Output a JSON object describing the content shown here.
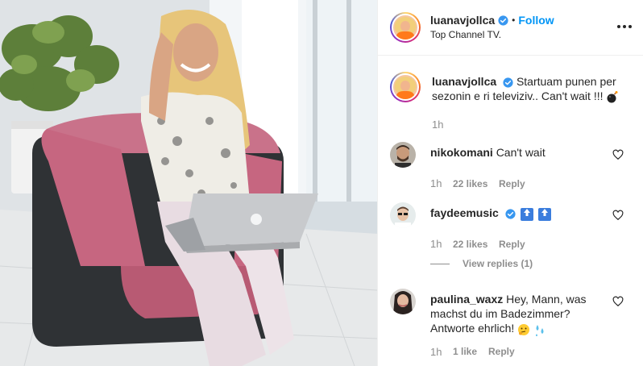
{
  "post": {
    "username": "luanavjollca",
    "dot": "•",
    "follow_label": "Follow",
    "location": "Top Channel TV."
  },
  "caption": {
    "username": "luanavjollca",
    "text": "Startuam punen per sezonin e ri televiziv.. Can't wait !!!",
    "emoji": "bomb-emoji",
    "time": "1h"
  },
  "comments": [
    {
      "username": "nikokomani",
      "verified": false,
      "text": "Can't wait",
      "time": "1h",
      "likes": "22 likes",
      "reply": "Reply"
    },
    {
      "username": "faydeemusic",
      "verified": true,
      "text": "",
      "emojis": [
        "top-arrow-emoji",
        "top-arrow-emoji"
      ],
      "time": "1h",
      "likes": "22 likes",
      "reply": "Reply",
      "view_replies": "View replies (1)"
    },
    {
      "username": "paulina_waxz",
      "verified": false,
      "text": "Hey, Mann, was machst du im Badezimmer? Antworte ehrlich!",
      "emojis": [
        "thinking-face-emoji",
        "sweat-droplets-emoji"
      ],
      "time": "1h",
      "likes": "1 like",
      "reply": "Reply"
    }
  ],
  "icons": {
    "verified": "verified-badge-icon",
    "more": "more-options-icon",
    "heart": "heart-icon"
  },
  "colors": {
    "accent": "#0095f6",
    "verified": "#3897f0",
    "muted": "#8e8e8e",
    "text": "#262626"
  }
}
